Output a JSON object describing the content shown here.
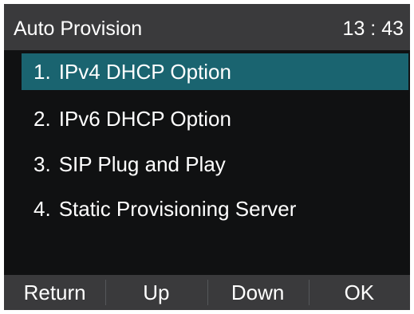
{
  "header": {
    "title": "Auto Provision",
    "time": "13 : 43"
  },
  "menu": {
    "selected_index": 0,
    "items": [
      {
        "number": "1.",
        "label": "IPv4 DHCP Option"
      },
      {
        "number": "2.",
        "label": "IPv6 DHCP Option"
      },
      {
        "number": "3.",
        "label": "SIP Plug and Play"
      },
      {
        "number": "4.",
        "label": "Static Provisioning Server"
      }
    ]
  },
  "softkeys": {
    "return_label": "Return",
    "up_label": "Up",
    "down_label": "Down",
    "ok_label": "OK"
  },
  "colors": {
    "selection": "#1a6470",
    "bar": "#3a3a3c",
    "background": "#101112"
  }
}
